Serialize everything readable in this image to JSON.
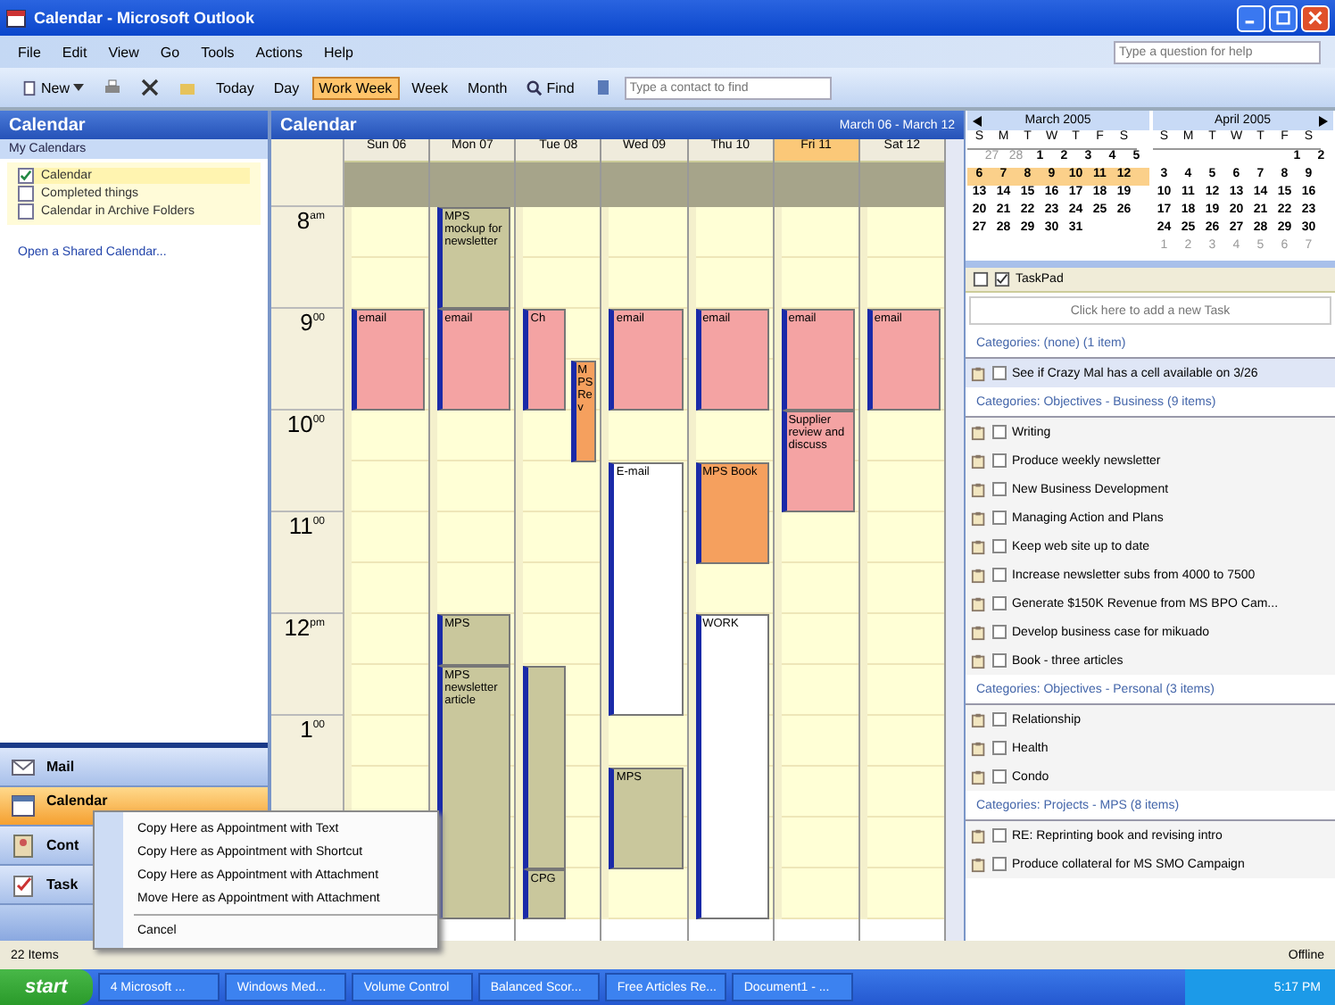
{
  "window": {
    "title": "Calendar - Microsoft Outlook"
  },
  "menu": [
    "File",
    "Edit",
    "View",
    "Go",
    "Tools",
    "Actions",
    "Help"
  ],
  "help_box": {
    "placeholder": "Type a question for help"
  },
  "toolbar": [
    {
      "kind": "new",
      "label": "New"
    },
    {
      "kind": "print"
    },
    {
      "kind": "delete"
    },
    {
      "kind": "move"
    },
    {
      "kind": "text",
      "label": "Today"
    },
    {
      "kind": "view",
      "label": "Day",
      "selected": false
    },
    {
      "kind": "view",
      "label": "Work Week",
      "selected": true
    },
    {
      "kind": "view",
      "label": "Week",
      "selected": false
    },
    {
      "kind": "view",
      "label": "Month",
      "selected": false
    },
    {
      "kind": "find",
      "label": "Find"
    },
    {
      "kind": "book"
    }
  ],
  "contact_field": {
    "placeholder": "Type a contact to find"
  },
  "left_pane": {
    "title": "Calendar",
    "section": "My Calendars",
    "calendars": [
      {
        "label": "Calendar",
        "checked": true,
        "selected": true
      },
      {
        "label": "Completed things",
        "checked": false,
        "selected": false
      },
      {
        "label": "Calendar in Archive Folders",
        "checked": false,
        "selected": false
      }
    ],
    "link": "Open a Shared Calendar...",
    "nav": [
      {
        "label": "Mail",
        "kind": "mail",
        "selected": false
      },
      {
        "label": "Calendar",
        "kind": "calendar",
        "selected": true
      },
      {
        "label": "Cont",
        "kind": "contacts",
        "selected": false
      },
      {
        "label": "Task",
        "kind": "tasks",
        "selected": false
      }
    ]
  },
  "calendar": {
    "title": "Calendar",
    "range": "March 06 - March 12",
    "times": [
      "8$^{am}$",
      "9$^{00}$",
      "10$^{00}$",
      "11$^{00}$",
      "12$^{pm}$",
      "1$^{00}$"
    ],
    "days": [
      {
        "label": "Sun 06",
        "today": false,
        "columns": [
          [
            {
              "kind": "free"
            },
            {
              "kind": "free"
            },
            {
              "kind": "appointment",
              "text": "email",
              "color": "#f4a3a3"
            },
            {
              "kind": "more"
            },
            {
              "kind": "free"
            },
            {
              "kind": "free"
            },
            {
              "kind": "free"
            },
            {
              "kind": "free"
            },
            {
              "kind": "free"
            },
            {
              "kind": "free"
            },
            {
              "kind": "free"
            },
            {
              "kind": "free"
            },
            {
              "kind": "free"
            },
            {
              "kind": "free"
            }
          ]
        ]
      },
      {
        "label": "Mon 07",
        "today": false,
        "columns": [
          [
            {
              "kind": "appointment",
              "text": "MPS mockup for newsletter",
              "color": "#c9c79c"
            },
            {
              "kind": "more"
            },
            {
              "kind": "appointment",
              "text": "email",
              "color": "#f4a3a3"
            },
            {
              "kind": "more"
            },
            {
              "kind": "free"
            },
            {
              "kind": "free"
            },
            {
              "kind": "free"
            },
            {
              "kind": "free"
            },
            {
              "kind": "appointment",
              "text": "MPS",
              "color": "#c9c79c"
            },
            {
              "kind": "appointment",
              "text": "MPS newsletter article",
              "color": "#c9c79c"
            },
            {
              "kind": "more"
            },
            {
              "kind": "more"
            },
            {
              "kind": "more"
            },
            {
              "kind": "more"
            }
          ]
        ]
      },
      {
        "label": "Tue 08",
        "today": false,
        "columns": [
          [
            {
              "kind": "free"
            },
            {
              "kind": "free"
            },
            {
              "kind": "appointment",
              "text": "Ch",
              "color": "#f4a3a3"
            },
            {
              "kind": "more"
            },
            {
              "kind": "free"
            },
            {
              "kind": "free"
            },
            {
              "kind": "free"
            },
            {
              "kind": "free"
            },
            {
              "kind": "free"
            },
            {
              "kind": "appointment",
              "color": "#c9c79c"
            },
            {
              "kind": "more"
            },
            {
              "kind": "more"
            },
            {
              "kind": "more"
            },
            {
              "kind": "appointment",
              "text": "CPG",
              "color": "#c9c79c"
            }
          ],
          [
            {
              "kind": "free"
            },
            {
              "kind": "free"
            },
            {
              "kind": "free"
            },
            {
              "kind": "appointment",
              "text": "MPS Rev",
              "color": "#f5a05e"
            },
            {
              "kind": "more"
            },
            {
              "kind": "free"
            },
            {
              "kind": "free"
            },
            {
              "kind": "free"
            },
            {
              "kind": "free"
            },
            {
              "kind": "free"
            },
            {
              "kind": "free"
            },
            {
              "kind": "free"
            },
            {
              "kind": "free"
            },
            {
              "kind": "free"
            }
          ]
        ]
      },
      {
        "label": "Wed 09",
        "today": false,
        "columns": [
          [
            {
              "kind": "free"
            },
            {
              "kind": "free"
            },
            {
              "kind": "appointment",
              "text": "email",
              "color": "#f4a3a3"
            },
            {
              "kind": "more"
            },
            {
              "kind": "free"
            },
            {
              "kind": "appointment",
              "text": "E-mail",
              "color": "#ffffff"
            },
            {
              "kind": "more"
            },
            {
              "kind": "more"
            },
            {
              "kind": "more"
            },
            {
              "kind": "more"
            },
            {
              "kind": "free"
            },
            {
              "kind": "appointment",
              "text": "MPS",
              "color": "#c9c79c"
            },
            {
              "kind": "more"
            },
            {
              "kind": "free"
            }
          ]
        ]
      },
      {
        "label": "Thu 10",
        "today": false,
        "columns": [
          [
            {
              "kind": "free"
            },
            {
              "kind": "free"
            },
            {
              "kind": "appointment",
              "text": "email",
              "color": "#f4a3a3"
            },
            {
              "kind": "more"
            },
            {
              "kind": "free"
            },
            {
              "kind": "appointment",
              "text": "MPS Book",
              "color": "#f5a05e"
            },
            {
              "kind": "more"
            },
            {
              "kind": "free"
            },
            {
              "kind": "appointment",
              "text": "WORK",
              "color": "#ffffff"
            },
            {
              "kind": "more"
            },
            {
              "kind": "more"
            },
            {
              "kind": "more"
            },
            {
              "kind": "more"
            },
            {
              "kind": "more"
            }
          ]
        ]
      },
      {
        "label": "Fri 11",
        "today": true,
        "columns": [
          [
            {
              "kind": "free"
            },
            {
              "kind": "free"
            },
            {
              "kind": "appointment",
              "text": "email",
              "color": "#f4a3a3"
            },
            {
              "kind": "more"
            },
            {
              "kind": "appointment",
              "text": "Supplier review and discuss",
              "color": "#f4a3a3"
            },
            {
              "kind": "more"
            },
            {
              "kind": "free"
            },
            {
              "kind": "free"
            },
            {
              "kind": "free"
            },
            {
              "kind": "free"
            },
            {
              "kind": "free"
            },
            {
              "kind": "free"
            },
            {
              "kind": "free"
            },
            {
              "kind": "free"
            }
          ]
        ]
      },
      {
        "label": "Sat 12",
        "today": false,
        "columns": [
          [
            {
              "kind": "free"
            },
            {
              "kind": "free"
            },
            {
              "kind": "appointment",
              "text": "email",
              "color": "#f4a3a3"
            },
            {
              "kind": "more"
            },
            {
              "kind": "free"
            },
            {
              "kind": "free"
            },
            {
              "kind": "free"
            },
            {
              "kind": "free"
            },
            {
              "kind": "free"
            },
            {
              "kind": "free"
            },
            {
              "kind": "free"
            },
            {
              "kind": "free"
            },
            {
              "kind": "free"
            },
            {
              "kind": "free"
            }
          ]
        ]
      }
    ]
  },
  "date_navigator": {
    "months": [
      {
        "title": "March 2005",
        "weekdays": [
          "S",
          "M",
          "T",
          "W",
          "T",
          "F",
          "S"
        ],
        "weeks": [
          {
            "dim_days": [
              "27",
              "28"
            ],
            "days": [
              "1",
              "2",
              "3",
              "4",
              "5"
            ],
            "selected": false
          },
          {
            "days": [
              "6",
              "7",
              "8",
              "9",
              "10",
              "11",
              "12"
            ],
            "selected": true
          },
          {
            "days": [
              "13",
              "14",
              "15",
              "16",
              "17",
              "18",
              "19"
            ],
            "selected": false
          },
          {
            "days": [
              "20",
              "21",
              "22",
              "23",
              "24",
              "25",
              "26"
            ],
            "selected": false
          },
          {
            "days": [
              "27",
              "28",
              "29",
              "30",
              "31"
            ],
            "selected": false
          }
        ]
      },
      {
        "title": "April 2005",
        "weekdays": [
          "S",
          "M",
          "T",
          "W",
          "T",
          "F",
          "S"
        ],
        "weeks": [
          {
            "days": [
              "1",
              "2"
            ],
            "selected": false
          },
          {
            "days": [
              "3",
              "4",
              "5",
              "6",
              "7",
              "8",
              "9"
            ],
            "selected": false
          },
          {
            "days": [
              "10",
              "11",
              "12",
              "13",
              "14",
              "15",
              "16"
            ],
            "selected": false
          },
          {
            "days": [
              "17",
              "18",
              "19",
              "20",
              "21",
              "22",
              "23"
            ],
            "selected": false
          },
          {
            "days": [
              "24",
              "25",
              "26",
              "27",
              "28",
              "29",
              "30"
            ],
            "selected": false
          },
          {
            "dim_days": [
              "1",
              "2",
              "3",
              "4",
              "5",
              "6",
              "7"
            ],
            "selected": false
          }
        ]
      }
    ]
  },
  "taskpad": {
    "title": "TaskPad",
    "new_task": {
      "placeholder": "Click here to add a new Task"
    },
    "groups": [
      {
        "title": "Categories: (none) (1 item)",
        "tasks": [
          {
            "text": "See if Crazy Mal has a cell available on 3/26",
            "checked": false,
            "selected": true
          }
        ]
      },
      {
        "title": "Categories: Objectives - Business (9 items)",
        "tasks": [
          {
            "text": "Writing",
            "checked": false,
            "selected": false
          },
          {
            "text": "Produce weekly newsletter",
            "checked": false,
            "selected": false
          },
          {
            "text": "New Business Development",
            "checked": false,
            "selected": false
          },
          {
            "text": "Managing Action and Plans",
            "checked": false,
            "selected": false
          },
          {
            "text": "Keep web site up to date",
            "checked": false,
            "selected": false
          },
          {
            "text": "Increase newsletter subs from 4000 to 7500",
            "checked": false,
            "selected": false
          },
          {
            "text": "Generate $150K Revenue from MS BPO Cam...",
            "checked": false,
            "selected": false
          },
          {
            "text": "Develop business case for mikuado",
            "checked": false,
            "selected": false
          },
          {
            "text": "Book - three articles",
            "checked": false,
            "selected": false
          }
        ]
      },
      {
        "title": "Categories: Objectives - Personal (3 items)",
        "tasks": [
          {
            "text": "Relationship",
            "checked": false,
            "selected": false
          },
          {
            "text": "Health",
            "checked": false,
            "selected": false
          },
          {
            "text": "Condo",
            "checked": false,
            "selected": false
          }
        ]
      },
      {
        "title": "Categories: Projects - MPS (8 items)",
        "tasks": [
          {
            "text": "RE: Reprinting book and revising intro",
            "checked": false,
            "selected": false
          },
          {
            "text": "Produce collateral for MS SMO Campaign",
            "checked": false,
            "selected": false
          }
        ]
      }
    ]
  },
  "context_menu": [
    {
      "label": "Copy Here as Appointment with Text",
      "kind": "item"
    },
    {
      "label": "Copy Here as Appointment with Shortcut",
      "kind": "item"
    },
    {
      "label": "Copy Here as Appointment with Attachment",
      "kind": "item"
    },
    {
      "label": "Move Here as Appointment with Attachment",
      "kind": "item"
    },
    {
      "kind": "separator"
    },
    {
      "label": "Cancel",
      "kind": "item"
    }
  ],
  "status_bar": {
    "items": "22 Items",
    "connection": "Offline"
  },
  "taskbar": {
    "start": "start",
    "buttons": [
      "4 Microsoft ...",
      "Windows Med...",
      "Volume Control",
      "Balanced Scor...",
      "Free Articles Re...",
      "Document1 - ..."
    ],
    "clock": "5:17 PM"
  }
}
